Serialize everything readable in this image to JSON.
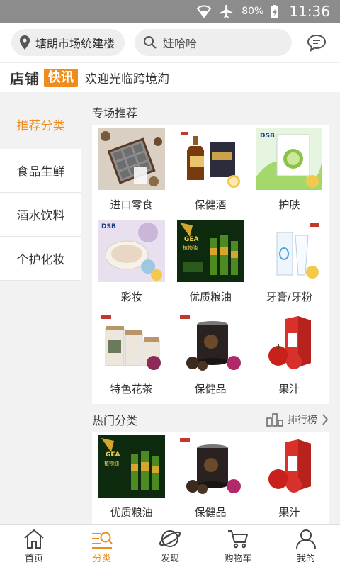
{
  "status_bar": {
    "battery": "80%",
    "time": "11:36"
  },
  "header": {
    "location": "塘朗市场统建楼",
    "search_placeholder": "娃哈哈"
  },
  "news": {
    "brand": "店铺",
    "tag": "快讯",
    "text": "欢迎光临跨境淘"
  },
  "sidebar": {
    "items": [
      {
        "label": "推荐分类"
      },
      {
        "label": "食品生鲜"
      },
      {
        "label": "酒水饮料"
      },
      {
        "label": "个护化妆"
      }
    ]
  },
  "special": {
    "title": "专场推荐",
    "items": [
      {
        "label": "进口零食",
        "icon": "chocolate-product-image"
      },
      {
        "label": "保健酒",
        "icon": "liquor-product-image"
      },
      {
        "label": "护肤",
        "icon": "face-mask-product-image"
      },
      {
        "label": "彩妆",
        "icon": "powder-compact-product-image"
      },
      {
        "label": "优质粮油",
        "icon": "olive-oil-product-image"
      },
      {
        "label": "牙膏/牙粉",
        "icon": "toothpaste-product-image"
      },
      {
        "label": "特色花茶",
        "icon": "tea-jars-product-image"
      },
      {
        "label": "保健品",
        "icon": "black-garlic-product-image"
      },
      {
        "label": "果汁",
        "icon": "juice-box-product-image"
      }
    ]
  },
  "hot": {
    "title": "热门分类",
    "ranking_label": "排行榜",
    "items": [
      {
        "label": "优质粮油",
        "icon": "olive-oil-product-image"
      },
      {
        "label": "保健品",
        "icon": "black-garlic-product-image"
      },
      {
        "label": "果汁",
        "icon": "juice-box-product-image"
      }
    ]
  },
  "bottom_nav": {
    "items": [
      {
        "label": "首页",
        "icon": "home-icon"
      },
      {
        "label": "分类",
        "icon": "category-icon"
      },
      {
        "label": "发现",
        "icon": "planet-icon"
      },
      {
        "label": "购物车",
        "icon": "cart-icon"
      },
      {
        "label": "我的",
        "icon": "user-icon"
      }
    ]
  },
  "colors": {
    "accent": "#f08c1c",
    "status_bar": "#8c8c8c",
    "background": "#f2f2f2"
  }
}
